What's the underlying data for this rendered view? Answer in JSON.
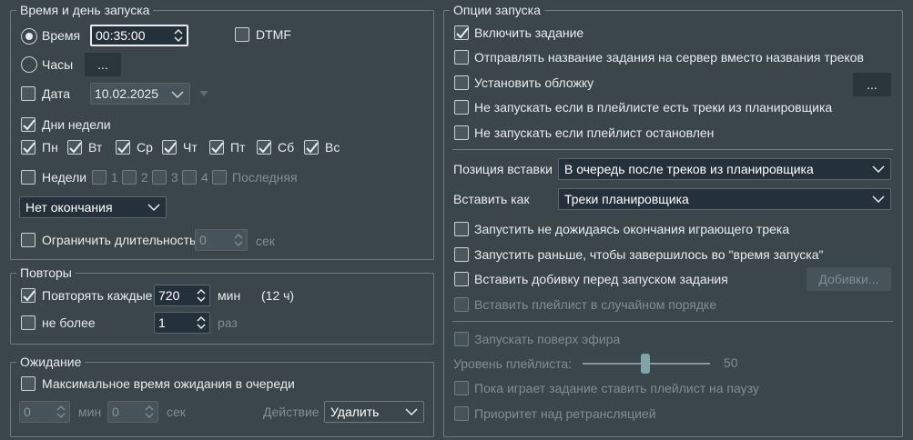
{
  "launch_group": {
    "title": "Время и день запуска",
    "time_label": "Время",
    "time_value": "00:35:00",
    "dtmf_label": "DTMF",
    "clock_label": "Часы",
    "clock_button": "...",
    "date_label": "Дата",
    "date_value": "10.02.2025",
    "weekdays_label": "Дни недели",
    "days": [
      "Пн",
      "Вт",
      "Ср",
      "Чт",
      "Пт",
      "Сб",
      "Вс"
    ],
    "weeks_label": "Недели",
    "weeks": [
      "1",
      "2",
      "3",
      "4",
      "Последняя"
    ],
    "end_option": "Нет окончания",
    "limit_label": "Ограничить длительность",
    "limit_value": "0",
    "limit_unit": "сек"
  },
  "repeat_group": {
    "title": "Повторы",
    "repeat_label": "Повторять каждые",
    "repeat_value": "720",
    "repeat_unit": "мин",
    "repeat_hint": "(12 ч)",
    "max_label": "не более",
    "max_value": "1",
    "max_unit": "раз"
  },
  "wait_group": {
    "title": "Ожидание",
    "max_wait_label": "Максимальное время ожидания в очереди",
    "min_value": "0",
    "min_unit": "мин",
    "sec_value": "0",
    "sec_unit": "сек",
    "action_label": "Действие",
    "action_value": "Удалить"
  },
  "options_group": {
    "title": "Опции запуска",
    "enable_label": "Включить задание",
    "send_name_label": "Отправлять название задания на сервер вместо названия треков",
    "cover_label": "Установить обложку",
    "cover_button": "...",
    "no_launch_scheduler_label": "Не запускать если в плейлисте есть треки из планировщика",
    "no_launch_stopped_label": "Не запускать если плейлист остановлен",
    "insert_position_label": "Позиция вставки",
    "insert_position_value": "В очередь после треков из планировщика",
    "insert_as_label": "Вставить как",
    "insert_as_value": "Треки планировщика",
    "no_wait_label": "Запустить не дожидаясь окончания играющего трека",
    "earlier_label": "Запустить раньше, чтобы завершилось во \"время запуска\"",
    "filler_label": "Вставить добивку перед запуском задания",
    "filler_button": "Добивки...",
    "random_label": "Вставить плейлист в случайном порядке",
    "over_air_label": "Запускать поверх эфира",
    "playlist_level_label": "Уровень плейлиста:",
    "playlist_level_value": "50",
    "pause_label": "Пока играет задание ставить плейлист на паузу",
    "priority_label": "Приоритет над ретрансляцией"
  },
  "state": {
    "time_selected": true,
    "weekdays_checked": true,
    "enable_checked": true,
    "repeat_checked": true,
    "slider_fraction": 0.5
  }
}
